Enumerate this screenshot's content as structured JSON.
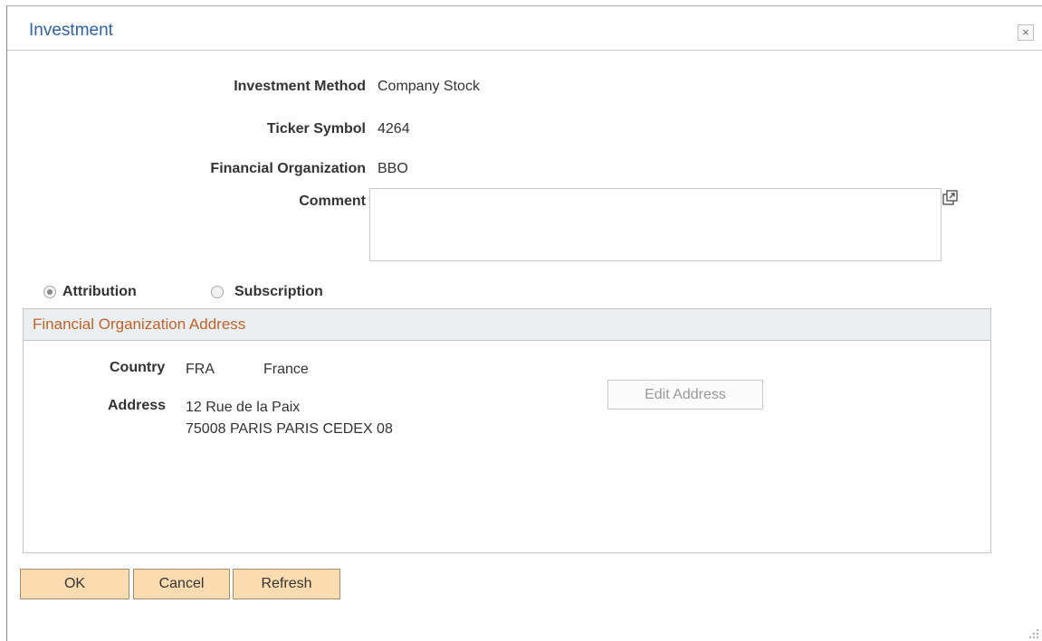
{
  "dialog": {
    "title": "Investment",
    "close_glyph": "×"
  },
  "fields": {
    "investment_method": {
      "label": "Investment Method",
      "value": "Company Stock"
    },
    "ticker_symbol": {
      "label": "Ticker Symbol",
      "value": "4264"
    },
    "financial_organization": {
      "label": "Financial Organization",
      "value": "BBO"
    },
    "comment": {
      "label": "Comment",
      "value": ""
    }
  },
  "options": {
    "attribution": {
      "label": "Attribution",
      "selected": true
    },
    "subscription": {
      "label": "Subscription",
      "selected": false
    }
  },
  "address_group": {
    "title": "Financial Organization Address",
    "country_label": "Country",
    "country_code": "FRA",
    "country_name": "France",
    "address_label": "Address",
    "address_line1": "12 Rue de la Paix",
    "address_line2": "75008 PARIS PARIS CEDEX 08",
    "edit_button": "Edit Address"
  },
  "buttons": {
    "ok": "OK",
    "cancel": "Cancel",
    "refresh": "Refresh"
  },
  "icons": {
    "close": "close-icon",
    "expand": "expand-icon",
    "resize": "resize-grip-icon"
  },
  "colors": {
    "title": "#2d63a6",
    "group_title": "#c0622a",
    "group_header_bg": "#eceff2",
    "button_bg": "#fbdcb0"
  }
}
